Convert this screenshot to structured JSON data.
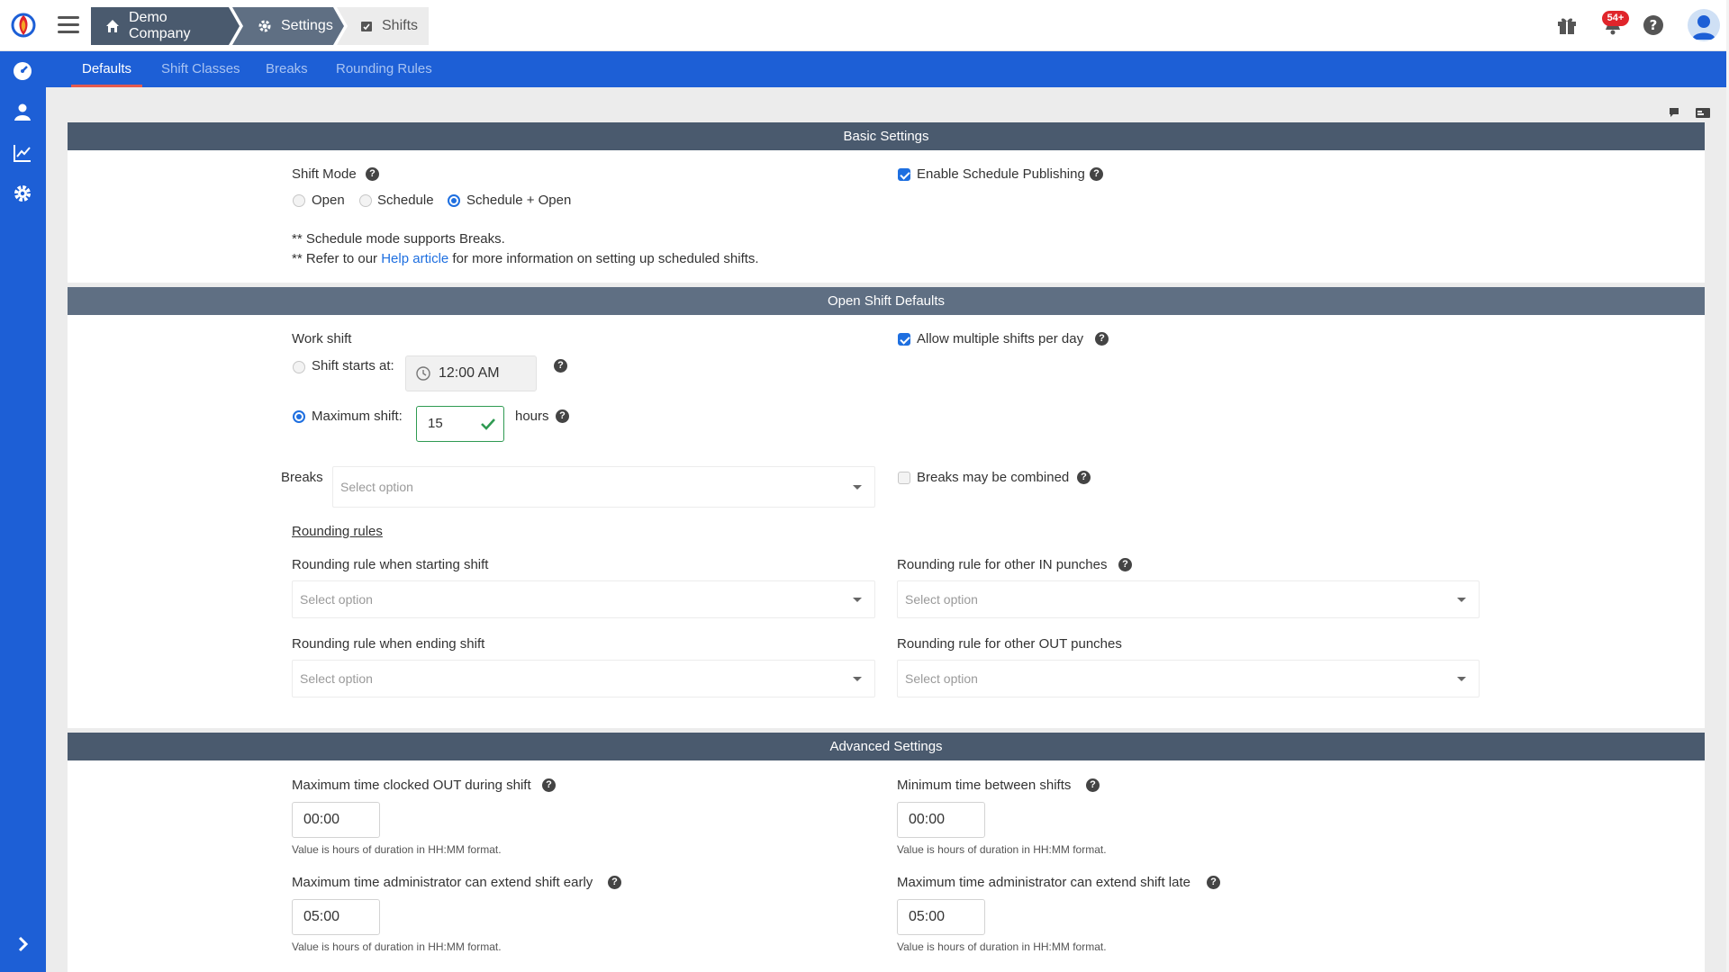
{
  "breadcrumb": {
    "company": "Demo Company",
    "settings": "Settings",
    "shifts": "Shifts"
  },
  "header": {
    "notification_badge": "54+"
  },
  "tabs": [
    "Defaults",
    "Shift Classes",
    "Breaks",
    "Rounding Rules"
  ],
  "basic": {
    "title": "Basic Settings",
    "shift_mode_label": "Shift Mode",
    "modes": [
      "Open",
      "Schedule",
      "Schedule + Open"
    ],
    "selected_mode": "Schedule + Open",
    "enable_publishing": "Enable Schedule Publishing",
    "note1": "** Schedule mode supports Breaks.",
    "note2_prefix": "** Refer to our",
    "note2_link": "Help article",
    "note2_suffix": "for more information on setting up scheduled shifts."
  },
  "open_shift": {
    "title": "Open Shift Defaults",
    "work_shift_label": "Work shift",
    "shift_starts_label": "Shift starts at:",
    "shift_starts_value": "12:00 AM",
    "max_shift_label": "Maximum shift:",
    "max_shift_value": "15",
    "hours_label": "hours",
    "allow_multiple": "Allow multiple shifts per day",
    "breaks_label": "Breaks",
    "breaks_placeholder": "Select option",
    "breaks_combined": "Breaks may be combined",
    "rounding_heading": "Rounding rules",
    "round_start": "Rounding rule when starting shift",
    "round_in": "Rounding rule for other IN punches",
    "round_end": "Rounding rule when ending shift",
    "round_out": "Rounding rule for other OUT punches",
    "placeholder": "Select option"
  },
  "advanced": {
    "title": "Advanced Settings",
    "max_out_label": "Maximum time clocked OUT during shift",
    "max_out_value": "00:00",
    "min_between_label": "Minimum time between shifts",
    "min_between_value": "00:00",
    "extend_early_label": "Maximum time administrator can extend shift early",
    "extend_early_value": "05:00",
    "extend_late_label": "Maximum time administrator can extend shift late",
    "extend_late_value": "05:00",
    "hint": "Value is hours of duration in HH:MM format."
  },
  "colors": {
    "primary": "#1d5fd6",
    "header_dark": "#4a5a6e",
    "header_mid": "#5f6f83",
    "accent": "#e35a4f",
    "valid": "#2f9a52"
  }
}
